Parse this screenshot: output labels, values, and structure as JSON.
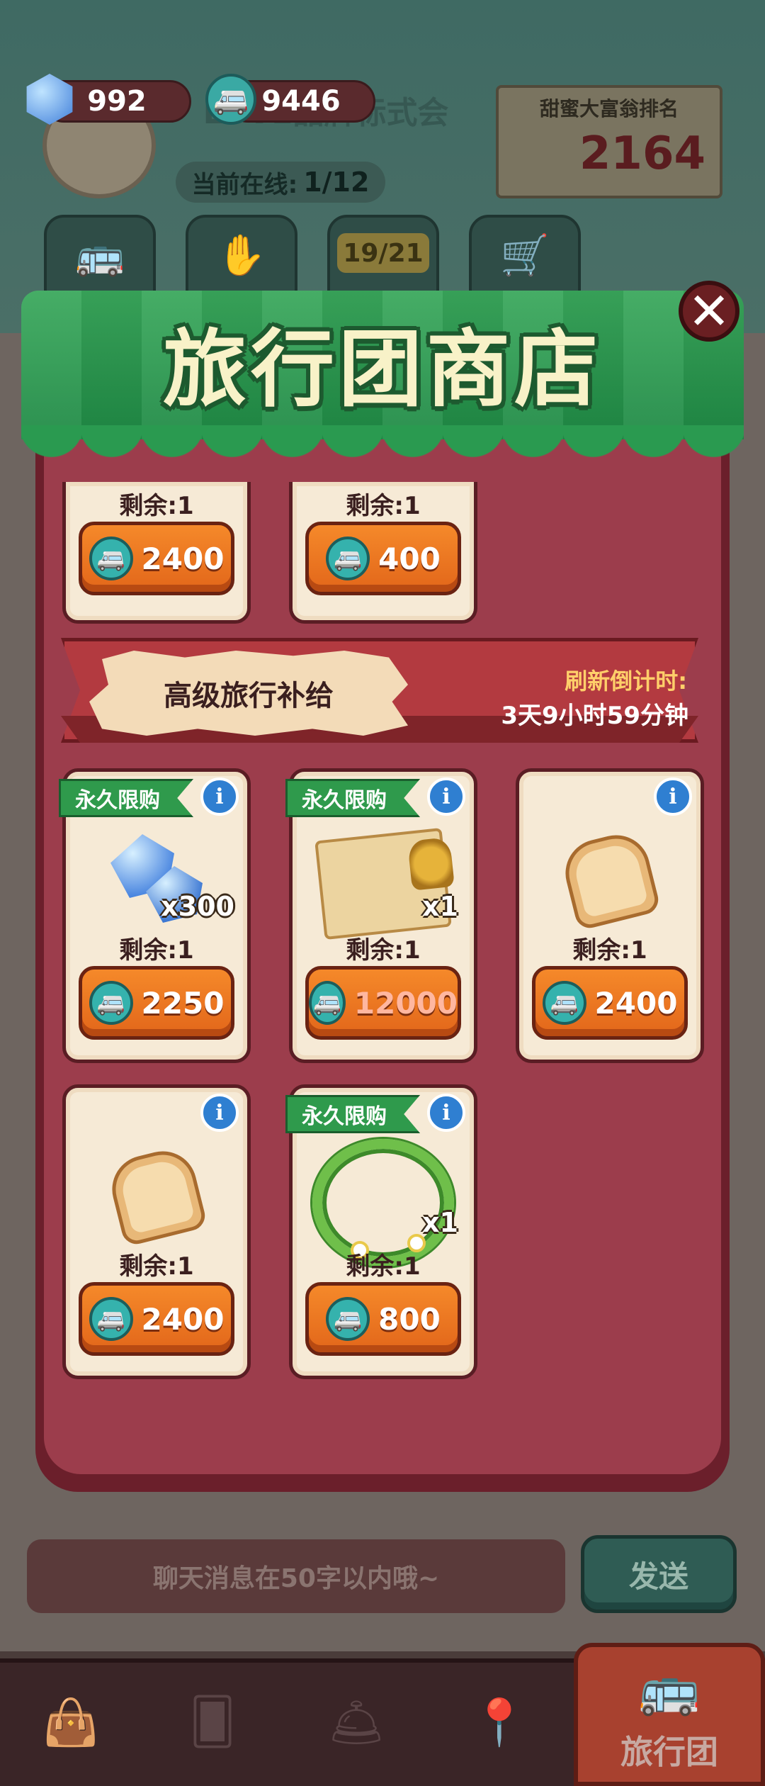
{
  "header": {
    "gems": "992",
    "van_tokens": "9446",
    "club_name": "LOVE品牌标式会",
    "online_label": "当前在线:",
    "online_value": "1/12",
    "rank_label": "甜蜜大富翁排名",
    "rank_value": "2164"
  },
  "top_tabs": [
    {
      "icon": "bus-icon"
    },
    {
      "icon": "helping-hand-icon"
    },
    {
      "icon": "challenge-icon",
      "count": "19/21"
    },
    {
      "icon": "cart-icon"
    }
  ],
  "shop": {
    "title": "旅行团商店",
    "close_label": "✕",
    "top_row": [
      {
        "remain": "剩余:1",
        "price": "2400"
      },
      {
        "remain": "剩余:1",
        "price": "400"
      }
    ],
    "section": {
      "title": "高级旅行补给",
      "refresh_label": "刷新倒计时:",
      "refresh_value": "3天9小时59分钟"
    },
    "items": [
      {
        "tag": "永久限购",
        "icon": "gems-icon",
        "qty": "x300",
        "remain": "剩余:1",
        "price": "2250"
      },
      {
        "tag": "永久限购",
        "icon": "treasure-map-icon",
        "qty": "x1",
        "remain": "剩余:1",
        "price": "12000",
        "price_red": true
      },
      {
        "tag": "",
        "icon": "bus-toast-icon",
        "qty": "",
        "remain": "剩余:1",
        "price": "2400"
      },
      {
        "tag": "",
        "icon": "tree-toast-icon",
        "qty": "",
        "remain": "剩余:1",
        "price": "2400"
      },
      {
        "tag": "永久限购",
        "icon": "flower-wreath-icon",
        "qty": "x1",
        "remain": "剩余:1",
        "price": "800"
      }
    ]
  },
  "chat": {
    "placeholder": "聊天消息在50字以内哦~",
    "send_label": "发送"
  },
  "nav": {
    "items": [
      {
        "icon": "bag-icon"
      },
      {
        "icon": "cards-icon"
      },
      {
        "icon": "service-bell-icon"
      },
      {
        "icon": "map-pin-icon"
      }
    ],
    "active_label": "旅行团"
  },
  "colors": {
    "shop_bg": "#9c3d4c",
    "awning_green": "#2a9a50",
    "price_orange": "#e2661a",
    "limit_tag_green": "#2f9a4c",
    "info_blue": "#2f7fd1"
  }
}
